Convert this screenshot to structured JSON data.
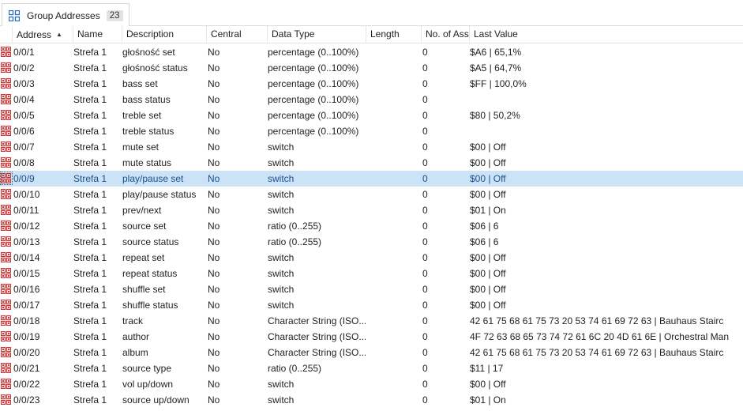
{
  "tab": {
    "icon": "group-address-grid-icon",
    "label": "Group Addresses",
    "count": "23"
  },
  "columns": {
    "address": "Address",
    "name": "Name",
    "description": "Description",
    "central": "Central",
    "data_type": "Data Type",
    "length": "Length",
    "no_of_associations": "No. of Ass",
    "last_value": "Last Value"
  },
  "sort": {
    "column": "address",
    "direction": "ascending",
    "icon": "sort-ascending-icon"
  },
  "selected_row": 8,
  "rows": [
    {
      "address": "0/0/1",
      "name": "Strefa 1",
      "description": "głośność set",
      "central": "No",
      "data_type": "percentage (0..100%)",
      "length": "",
      "associations": "0",
      "last_value": "$A6 | 65,1%"
    },
    {
      "address": "0/0/2",
      "name": "Strefa 1",
      "description": "głośność status",
      "central": "No",
      "data_type": "percentage (0..100%)",
      "length": "",
      "associations": "0",
      "last_value": "$A5 | 64,7%"
    },
    {
      "address": "0/0/3",
      "name": "Strefa 1",
      "description": "bass set",
      "central": "No",
      "data_type": "percentage (0..100%)",
      "length": "",
      "associations": "0",
      "last_value": "$FF | 100,0%"
    },
    {
      "address": "0/0/4",
      "name": "Strefa 1",
      "description": "bass status",
      "central": "No",
      "data_type": "percentage (0..100%)",
      "length": "",
      "associations": "0",
      "last_value": ""
    },
    {
      "address": "0/0/5",
      "name": "Strefa 1",
      "description": "treble set",
      "central": "No",
      "data_type": "percentage (0..100%)",
      "length": "",
      "associations": "0",
      "last_value": "$80 | 50,2%"
    },
    {
      "address": "0/0/6",
      "name": "Strefa 1",
      "description": "treble status",
      "central": "No",
      "data_type": "percentage (0..100%)",
      "length": "",
      "associations": "0",
      "last_value": ""
    },
    {
      "address": "0/0/7",
      "name": "Strefa 1",
      "description": "mute set",
      "central": "No",
      "data_type": "switch",
      "length": "",
      "associations": "0",
      "last_value": "$00 | Off"
    },
    {
      "address": "0/0/8",
      "name": "Strefa 1",
      "description": "mute status",
      "central": "No",
      "data_type": "switch",
      "length": "",
      "associations": "0",
      "last_value": "$00 | Off"
    },
    {
      "address": "0/0/9",
      "name": "Strefa 1",
      "description": "play/pause set",
      "central": "No",
      "data_type": "switch",
      "length": "",
      "associations": "0",
      "last_value": "$00 | Off"
    },
    {
      "address": "0/0/10",
      "name": "Strefa 1",
      "description": "play/pause status",
      "central": "No",
      "data_type": "switch",
      "length": "",
      "associations": "0",
      "last_value": "$00 | Off"
    },
    {
      "address": "0/0/11",
      "name": "Strefa 1",
      "description": "prev/next",
      "central": "No",
      "data_type": "switch",
      "length": "",
      "associations": "0",
      "last_value": "$01 | On"
    },
    {
      "address": "0/0/12",
      "name": "Strefa 1",
      "description": "source set",
      "central": "No",
      "data_type": "ratio (0..255)",
      "length": "",
      "associations": "0",
      "last_value": "$06 | 6"
    },
    {
      "address": "0/0/13",
      "name": "Strefa 1",
      "description": "source status",
      "central": "No",
      "data_type": "ratio (0..255)",
      "length": "",
      "associations": "0",
      "last_value": "$06 | 6"
    },
    {
      "address": "0/0/14",
      "name": "Strefa 1",
      "description": "repeat set",
      "central": "No",
      "data_type": "switch",
      "length": "",
      "associations": "0",
      "last_value": "$00 | Off"
    },
    {
      "address": "0/0/15",
      "name": "Strefa 1",
      "description": "repeat status",
      "central": "No",
      "data_type": "switch",
      "length": "",
      "associations": "0",
      "last_value": "$00 | Off"
    },
    {
      "address": "0/0/16",
      "name": "Strefa 1",
      "description": "shuffle set",
      "central": "No",
      "data_type": "switch",
      "length": "",
      "associations": "0",
      "last_value": "$00 | Off"
    },
    {
      "address": "0/0/17",
      "name": "Strefa 1",
      "description": "shuffle status",
      "central": "No",
      "data_type": "switch",
      "length": "",
      "associations": "0",
      "last_value": "$00 | Off"
    },
    {
      "address": "0/0/18",
      "name": "Strefa 1",
      "description": "track",
      "central": "No",
      "data_type": "Character String (ISO...",
      "length": "",
      "associations": "0",
      "last_value": "42 61 75 68 61 75 73 20 53 74 61 69 72 63 | Bauhaus Stairc"
    },
    {
      "address": "0/0/19",
      "name": "Strefa 1",
      "description": "author",
      "central": "No",
      "data_type": "Character String (ISO...",
      "length": "",
      "associations": "0",
      "last_value": "4F 72 63 68 65 73 74 72 61 6C 20 4D 61 6E | Orchestral Man"
    },
    {
      "address": "0/0/20",
      "name": "Strefa 1",
      "description": "album",
      "central": "No",
      "data_type": "Character String (ISO...",
      "length": "",
      "associations": "0",
      "last_value": "42 61 75 68 61 75 73 20 53 74 61 69 72 63 | Bauhaus Stairc"
    },
    {
      "address": "0/0/21",
      "name": "Strefa 1",
      "description": "source type",
      "central": "No",
      "data_type": "ratio (0..255)",
      "length": "",
      "associations": "0",
      "last_value": "$11 | 17"
    },
    {
      "address": "0/0/22",
      "name": "Strefa 1",
      "description": "vol up/down",
      "central": "No",
      "data_type": "switch",
      "length": "",
      "associations": "0",
      "last_value": "$00 | Off"
    },
    {
      "address": "0/0/23",
      "name": "Strefa 1",
      "description": "source up/down",
      "central": "No",
      "data_type": "switch",
      "length": "",
      "associations": "0",
      "last_value": "$01 | On"
    }
  ],
  "colors": {
    "accent": "#2b6cc4",
    "selected_row_bg": "#cce3f7",
    "selected_text": "#1a4f8a",
    "address_icon": "#d32f2f"
  }
}
